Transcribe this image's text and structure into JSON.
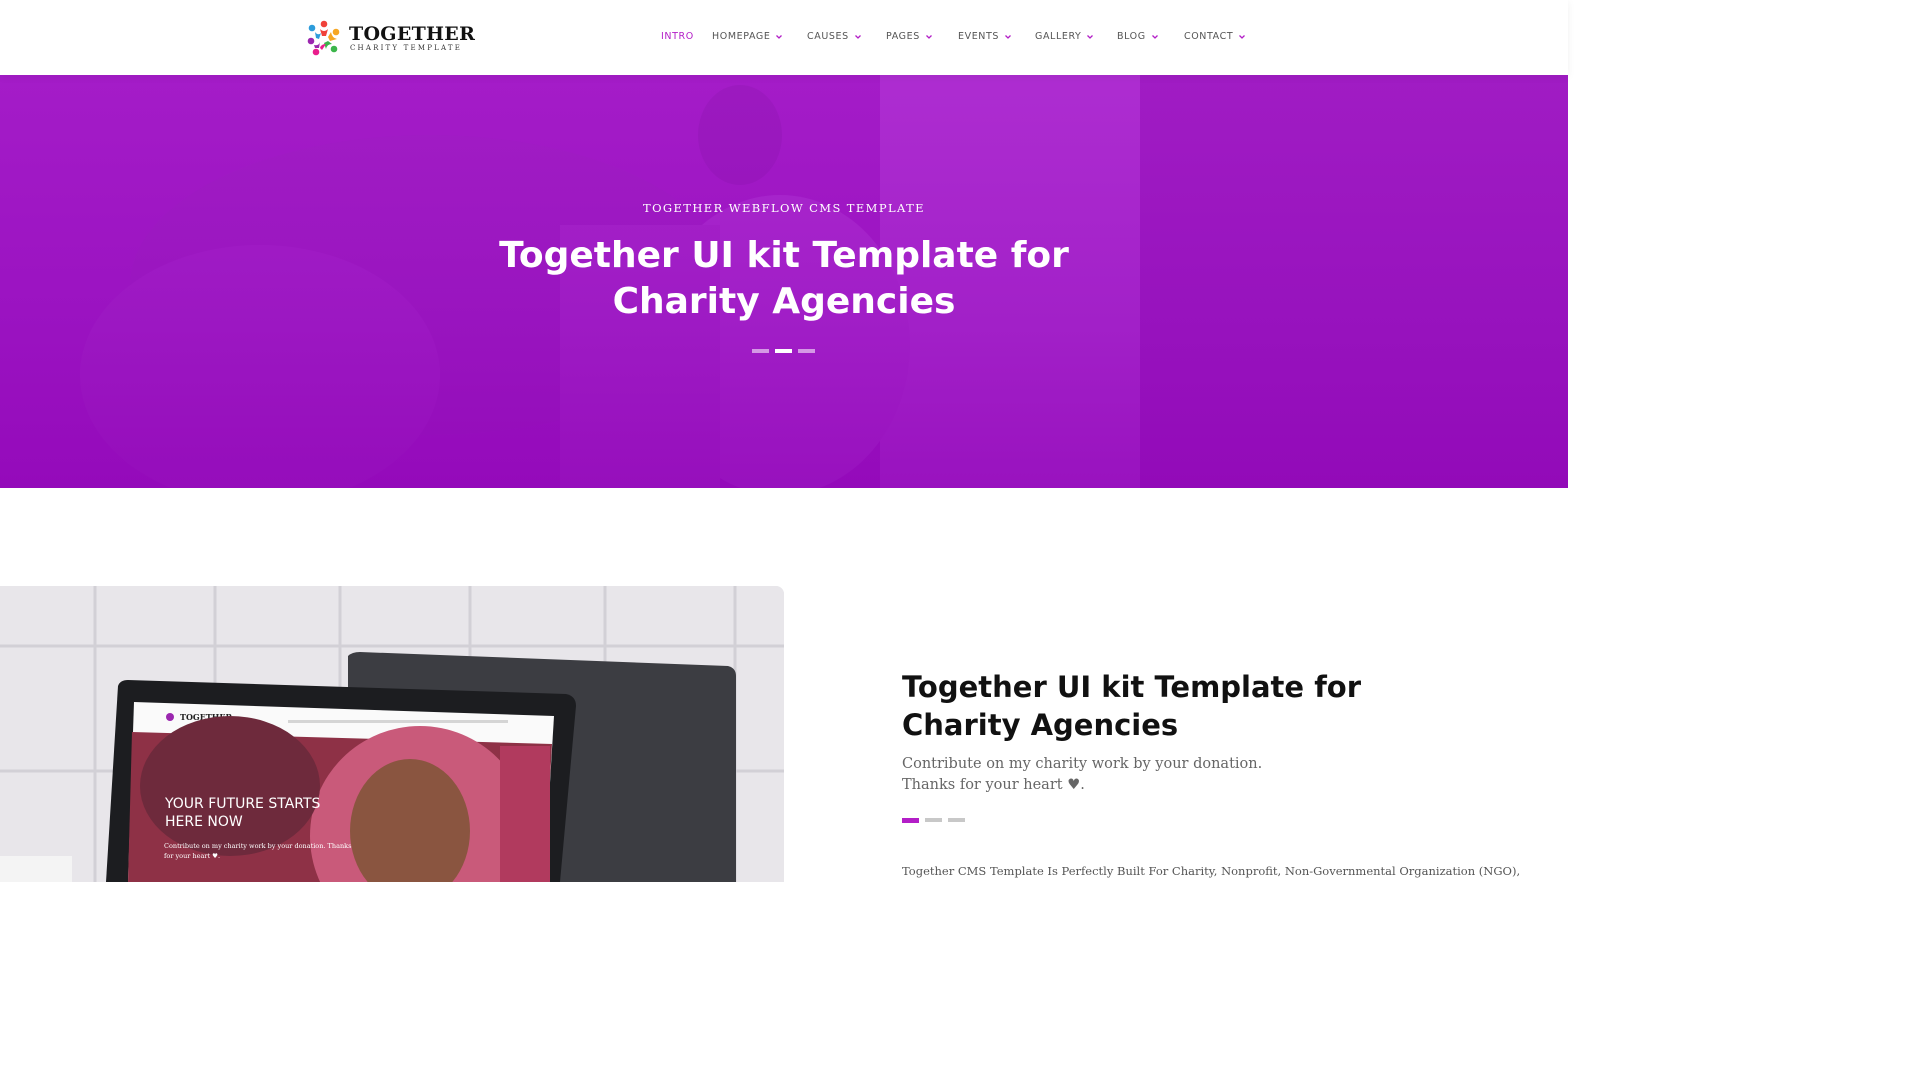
{
  "header": {
    "logo": {
      "title": "TOGETHER",
      "subtitle": "CHARITY TEMPLATE",
      "icon": "people-circle-logo",
      "colors": [
        "#f0413a",
        "#f6a623",
        "#3bb54a",
        "#2d9cdb",
        "#9b27af",
        "#e91e8c"
      ]
    },
    "nav": [
      {
        "label": "INTRO",
        "dropdown": false,
        "active": true
      },
      {
        "label": "HOMEPAGE",
        "dropdown": true,
        "active": false
      },
      {
        "label": "CAUSES",
        "dropdown": true,
        "active": false
      },
      {
        "label": "PAGES",
        "dropdown": true,
        "active": false
      },
      {
        "label": "EVENTS",
        "dropdown": true,
        "active": false
      },
      {
        "label": "GALLERY",
        "dropdown": true,
        "active": false
      },
      {
        "label": "BLOG",
        "dropdown": true,
        "active": false
      },
      {
        "label": "CONTACT",
        "dropdown": true,
        "active": false
      }
    ]
  },
  "hero": {
    "eyebrow": "TOGETHER WEBFLOW CMS TEMPLATE",
    "title": "Together UI kit Template for Charity Agencies",
    "slides": 3,
    "active_slide": 2
  },
  "feature": {
    "title": "Together UI kit Template for Charity Agencies",
    "subtitle": "Contribute on my charity work by your donation.\nThanks for your heart ♥.",
    "slides": 3,
    "active_slide": 1,
    "body": "Together CMS Template Is Perfectly Built For Charity, Nonprofit, Non-Governmental Organization (NGO),"
  },
  "mockup": {
    "logo_text": "TOGETHER",
    "headline": "YOUR FUTURE STARTS HERE NOW",
    "caption": "Contribute on my charity work by your donation. Thanks for your heart ♥."
  },
  "colors": {
    "accent": "#b31ec7",
    "hero_overlay": "#a210c7",
    "nav_text": "#555555",
    "heading": "#111111"
  }
}
